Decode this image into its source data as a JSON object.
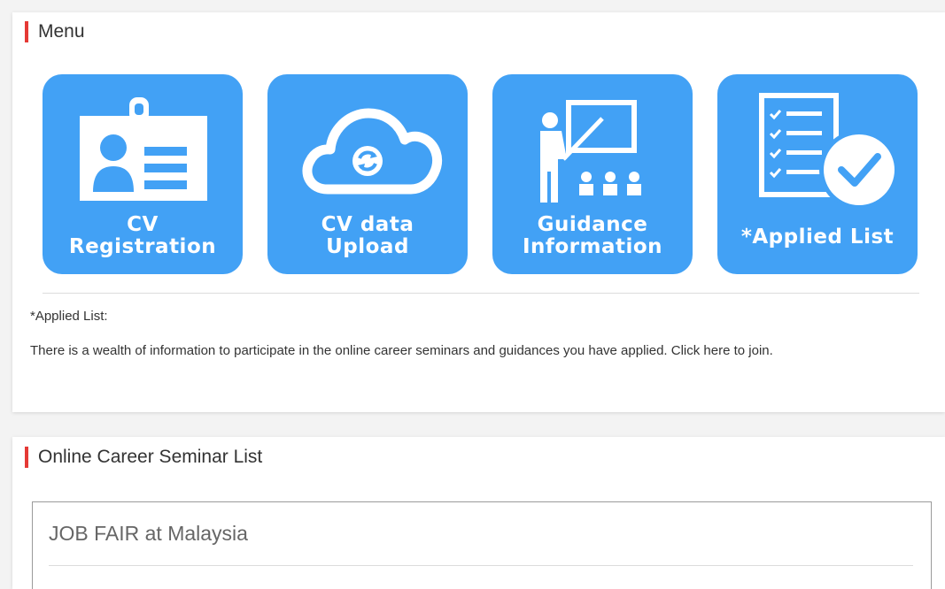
{
  "menu": {
    "title": "Menu",
    "tiles": [
      {
        "icon": "id-card-icon",
        "line1": "CV",
        "line2": "Registration"
      },
      {
        "icon": "cloud-sync-icon",
        "line1": "CV data",
        "line2": "Upload"
      },
      {
        "icon": "presentation-icon",
        "line1": "Guidance",
        "line2": "Information"
      },
      {
        "icon": "checklist-icon",
        "line1": "*Applied List"
      }
    ],
    "note_heading": "*Applied List:",
    "note_text": "There is a wealth of information to participate in the online career seminars and guidances you have applied. Click here to join."
  },
  "seminars": {
    "title": "Online Career Seminar List",
    "items": [
      {
        "name": "JOB FAIR at Malaysia"
      }
    ]
  },
  "colors": {
    "tile_background": "#42a1f5",
    "accent_bar": "#e53935"
  }
}
